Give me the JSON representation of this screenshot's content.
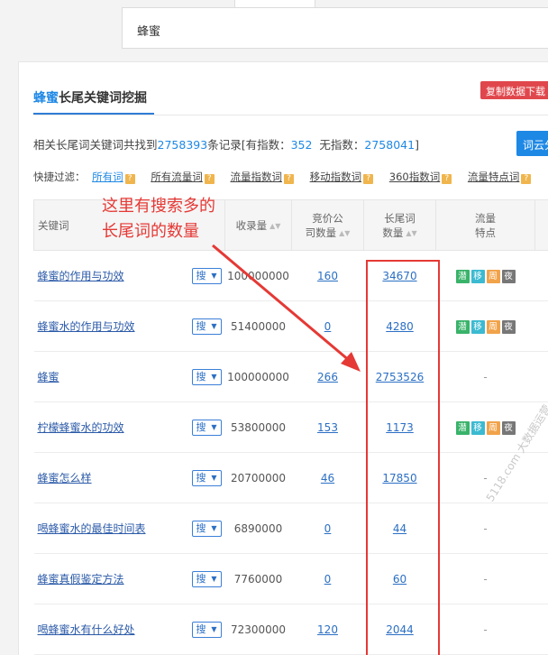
{
  "search": {
    "query": "蜂蜜"
  },
  "header": {
    "title_keyword": "蜂蜜",
    "title_rest": "长尾关键词挖掘",
    "copy_button": "复制数据下载"
  },
  "summary": {
    "prefix": "相关长尾词关键词共找到",
    "total": "2758393",
    "mid1": "条记录[有指数：",
    "with_index": "352",
    "mid2": "无指数：",
    "without_index": "2758041",
    "suffix": "]",
    "cloud_button": "词云分"
  },
  "filters": {
    "label": "快捷过滤：",
    "items": [
      "所有词",
      "所有流量词",
      "流量指数词",
      "移动指数词",
      "360指数词",
      "流量特点词"
    ]
  },
  "table": {
    "headers": {
      "keyword": "关键词",
      "indexed": "收录量",
      "bid_line1": "竞价公",
      "bid_line2": "司数量",
      "longtail_line1": "长尾词",
      "longtail_line2": "数量",
      "traffic_line1": "流量",
      "traffic_line2": "特点"
    },
    "search_btn": "搜",
    "tag_labels": {
      "q": "潜",
      "y": "移",
      "z": "周",
      "ye": "夜"
    },
    "rows": [
      {
        "kw_pre": "",
        "kw_hl": "蜂蜜",
        "kw_post": "的作用与功效",
        "indexed": "100000000",
        "bid": "160",
        "longtail": "34670",
        "tags": true
      },
      {
        "kw_pre": "",
        "kw_hl": "蜂蜜",
        "kw_post": "水的作用与功效",
        "indexed": "51400000",
        "bid": "0",
        "longtail": "4280",
        "tags": true
      },
      {
        "kw_pre": "",
        "kw_hl": "蜂蜜",
        "kw_post": "",
        "indexed": "100000000",
        "bid": "266",
        "longtail": "2753526",
        "tags": false
      },
      {
        "kw_pre": "柠檬",
        "kw_hl": "蜂蜜",
        "kw_post": "水的功效",
        "indexed": "53800000",
        "bid": "153",
        "longtail": "1173",
        "tags": true
      },
      {
        "kw_pre": "",
        "kw_hl": "蜂蜜",
        "kw_post": "怎么样",
        "indexed": "20700000",
        "bid": "46",
        "longtail": "17850",
        "tags": false
      },
      {
        "kw_pre": "喝",
        "kw_hl": "蜂蜜",
        "kw_post": "水的最佳时间表",
        "indexed": "6890000",
        "bid": "0",
        "longtail": "44",
        "tags": false
      },
      {
        "kw_pre": "",
        "kw_hl": "蜂蜜",
        "kw_post": "真假鉴定方法",
        "indexed": "7760000",
        "bid": "0",
        "longtail": "60",
        "tags": false
      },
      {
        "kw_pre": "喝",
        "kw_hl": "蜂蜜",
        "kw_post": "水有什么好处",
        "indexed": "72300000",
        "bid": "120",
        "longtail": "2044",
        "tags": false
      }
    ],
    "empty_marker": "-"
  },
  "annotation": {
    "line1": "这里有搜索多的",
    "line2": "长尾词的数量",
    "color": "#e53935"
  },
  "watermark": "5118.com 大数据运营"
}
